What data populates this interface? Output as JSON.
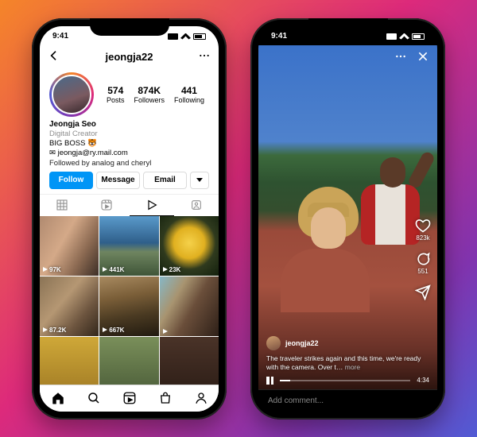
{
  "statusbar": {
    "time": "9:41"
  },
  "profile": {
    "navbar": {
      "username": "jeongja22"
    },
    "stats": {
      "posts": {
        "value": "574",
        "label": "Posts"
      },
      "followers": {
        "value": "874K",
        "label": "Followers"
      },
      "following": {
        "value": "441",
        "label": "Following"
      }
    },
    "bio": {
      "display_name": "Jeongja Seo",
      "category": "Digital Creator",
      "line1": "BIG BOSS 🐯",
      "email": "✉ jeongja@ry.mail.com",
      "followed_by": "Followed by analog and cheryl"
    },
    "buttons": {
      "follow": "Follow",
      "message": "Message",
      "email": "Email"
    },
    "grid": [
      {
        "views": "97K"
      },
      {
        "views": "441K"
      },
      {
        "views": "23K"
      },
      {
        "views": "87.2K"
      },
      {
        "views": "667K"
      },
      {
        "views": ""
      }
    ]
  },
  "video": {
    "likes_count": "823k",
    "comments_count": "551",
    "author_username": "jeongja22",
    "caption_text": "The traveler strikes again and this time, we're ready with the camera. Over t…",
    "caption_more": " more",
    "progress_time": "4:34",
    "comment_placeholder": "Add comment..."
  }
}
